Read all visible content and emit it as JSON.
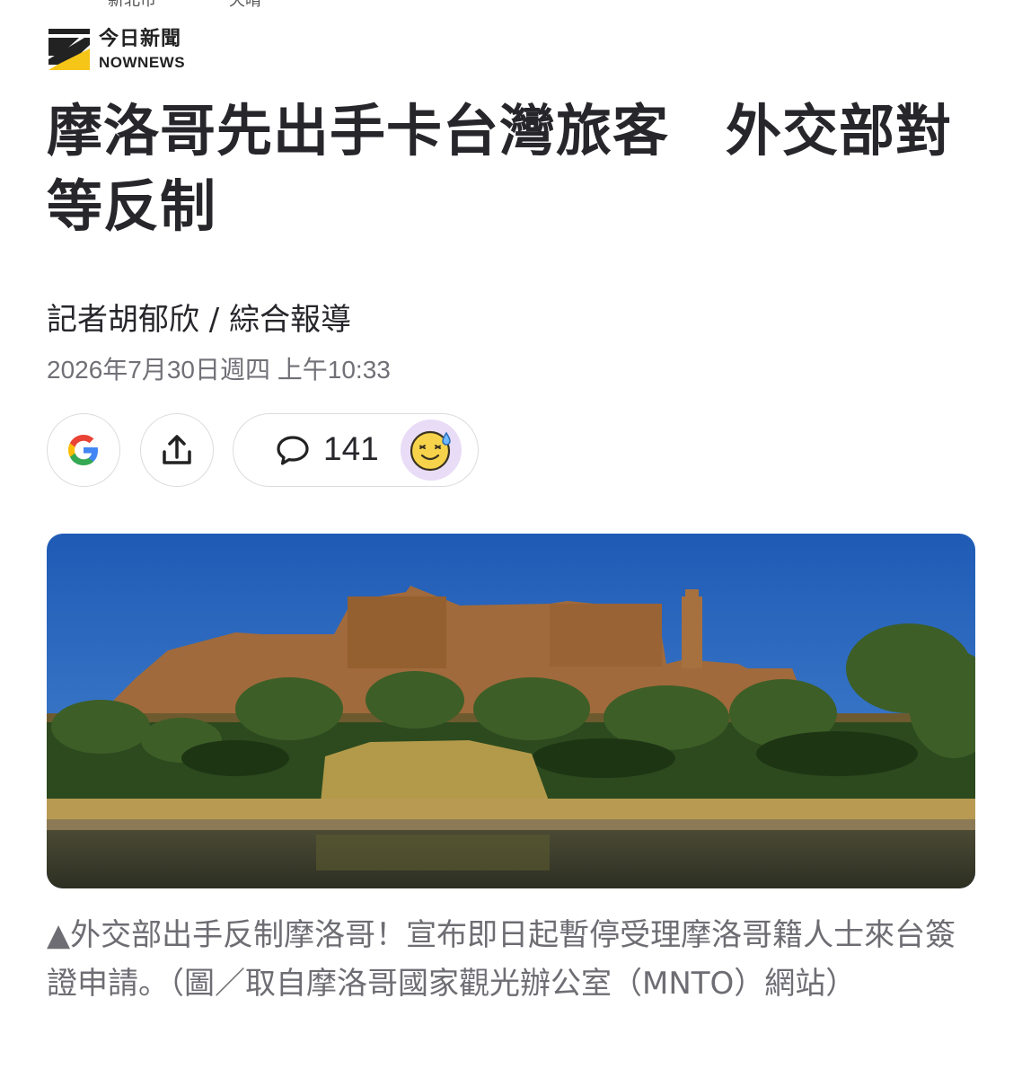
{
  "top_cut": {
    "left_text": "新北市",
    "right_text": "天晴"
  },
  "brand": {
    "name_cn": "今日新聞",
    "name_en": "NOWNEWS"
  },
  "article": {
    "title": "摩洛哥先出手卡台灣旅客　外交部對等反制",
    "byline": "記者胡郁欣 / 綜合報導",
    "datetime": "2026年7月30日週四 上午10:33"
  },
  "actions": {
    "google_icon": "google-icon",
    "share_icon": "share-icon",
    "comment_icon": "comment-bubble-icon",
    "comment_count": "141",
    "reaction_icon": "sweat-smile-emoji-icon"
  },
  "image": {
    "subject": "moroccan-kasbah-photo"
  },
  "caption": "▲外交部出手反制摩洛哥！宣布即日起暫停受理摩洛哥籍人士來台簽證申請。（圖／取自摩洛哥國家觀光辦公室（MNTO）網站）",
  "colors": {
    "google_blue": "#4285F4",
    "google_red": "#EA4335",
    "google_yellow": "#FBBC05",
    "google_green": "#34A853",
    "brand_yellow": "#F5C518",
    "reaction_bg": "#E9DCF7"
  }
}
